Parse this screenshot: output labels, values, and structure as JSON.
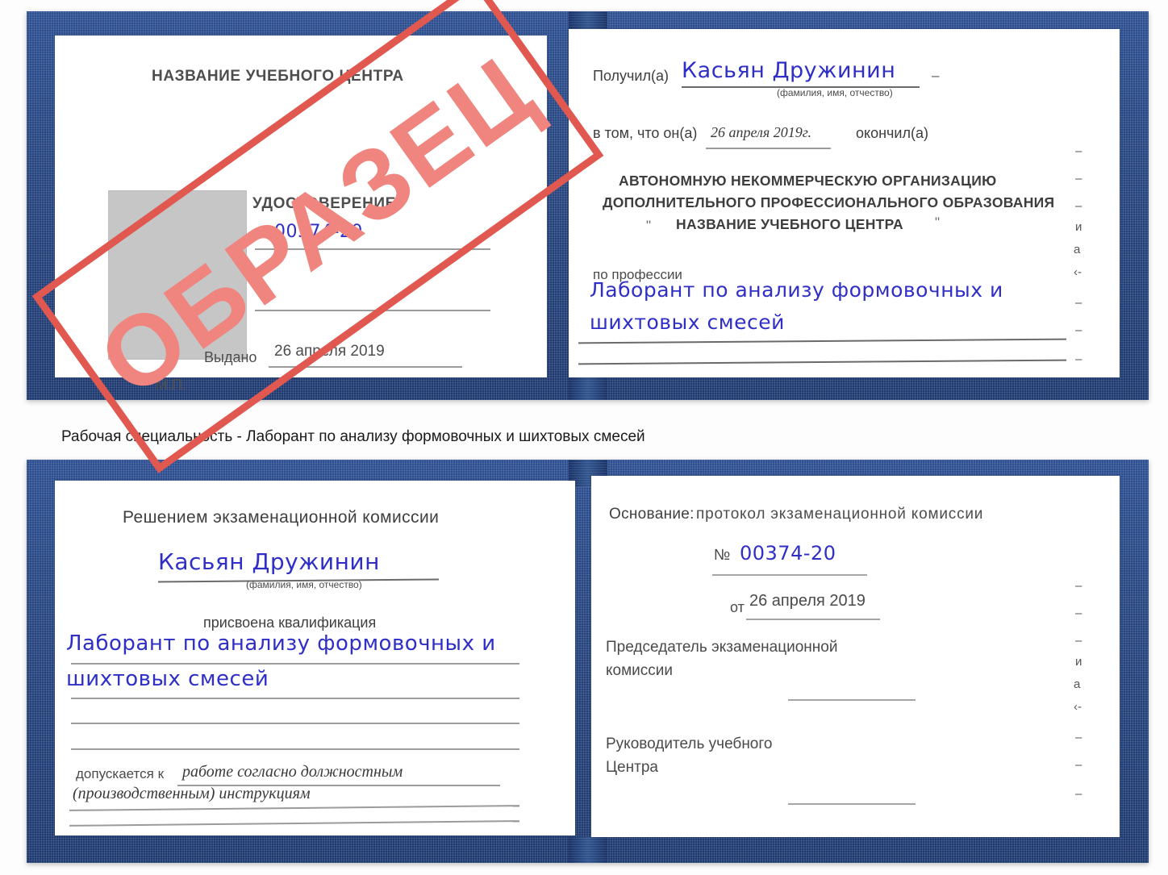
{
  "colors": {
    "cover_blue": "#27457f",
    "stamp_red": "#e0584f",
    "stamp_text_red": "#ef857e",
    "handwriting_blue": "#2f2fc7",
    "photo_placeholder_gray": "#c6c6c6",
    "rule_gray": "#8d8d8d"
  },
  "caption": "Рабочая специальность - Лаборант по анализу формовочных и шихтовых смесей",
  "stamp": {
    "text": "ОБРАЗЕЦ"
  },
  "certificate_top": {
    "left_page": {
      "center_name": "НАЗВАНИЕ УЧЕБНОГО ЦЕНТРА",
      "doc_title": "УДОСТОВЕРЕНИЕ",
      "number_label": "№",
      "number_value": "00374-20",
      "issued_label": "Выдано",
      "issued_value": "26 апреля 2019",
      "seal_label": "М.П."
    },
    "right_page": {
      "received_label": "Получил(а)",
      "received_value": "Касьян Дружинин",
      "fio_hint": "(фамилия, имя, отчество)",
      "in_that_label": "в том, что он(а)",
      "date_value": "26 апреля 2019г.",
      "finished_label": "окончил(а)",
      "org_line_1": "АВТОНОМНУЮ НЕКОММЕРЧЕСКУЮ ОРГАНИЗАЦИЮ",
      "org_line_2": "ДОПОЛНИТЕЛЬНОГО ПРОФЕССИОНАЛЬНОГО ОБРАЗОВАНИЯ",
      "org_quote_open": "\"",
      "org_line_3": "НАЗВАНИЕ УЧЕБНОГО ЦЕНТРА",
      "org_quote_close": "\"",
      "profession_label": "по профессии",
      "profession_value_1": "Лаборант по анализу формовочных и",
      "profession_value_2": "шихтовых смесей",
      "edge_fragments": [
        "–",
        "–",
        "–",
        "и",
        "а",
        "‹-",
        "–",
        "–",
        "–"
      ]
    }
  },
  "certificate_bottom": {
    "left_page": {
      "heading": "Решением экзаменационной комиссии",
      "name_value": "Касьян Дружинин",
      "fio_hint": "(фамилия, имя, отчество)",
      "qualification_label": "присвоена квалификация",
      "qualification_value_1": "Лаборант по анализу формовочных и",
      "qualification_value_2": "шихтовых смесей",
      "admitted_label": "допускается к",
      "admitted_value_1": "работе согласно должностным",
      "admitted_value_2": "(производственным) инструкциям"
    },
    "right_page": {
      "basis_label": "Основание:",
      "basis_value": "протокол экзаменационной комиссии",
      "number_label": "№",
      "number_value": "00374-20",
      "from_label": "от",
      "from_value": "26 апреля 2019",
      "chair_line_1": "Председатель экзаменационной",
      "chair_line_2": "комиссии",
      "head_line_1": "Руководитель учебного",
      "head_line_2": "Центра",
      "edge_fragments": [
        "–",
        "–",
        "–",
        "и",
        "а",
        "‹-",
        "–",
        "–",
        "–"
      ]
    }
  }
}
